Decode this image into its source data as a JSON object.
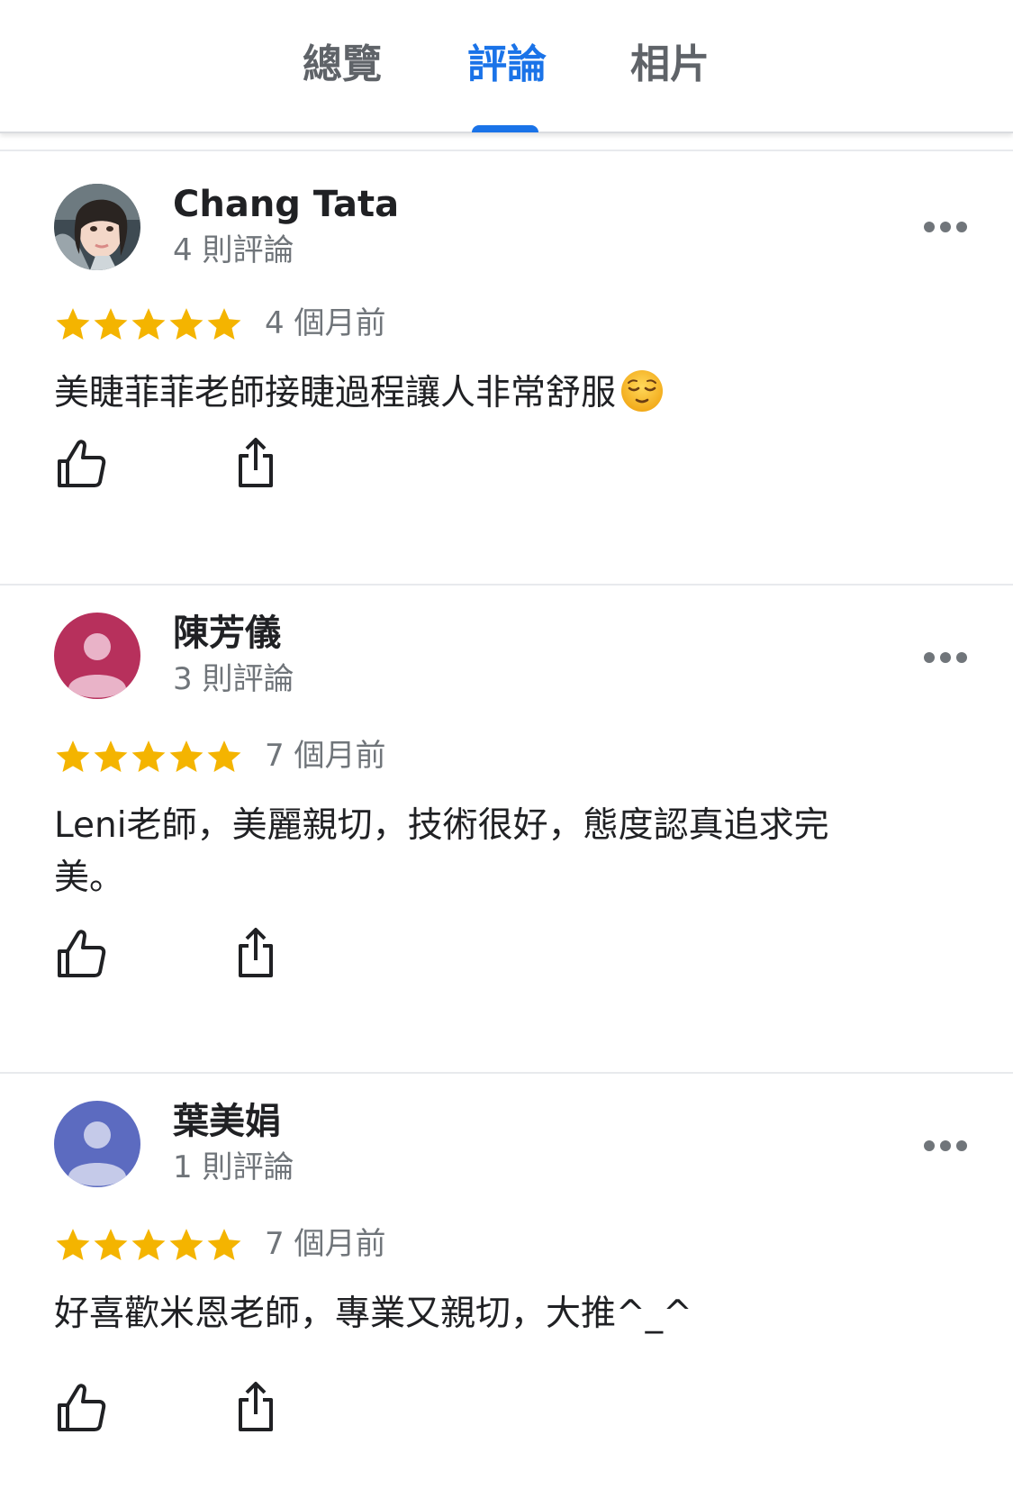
{
  "tabs": [
    {
      "label": "總覽",
      "active": false
    },
    {
      "label": "評論",
      "active": true
    },
    {
      "label": "相片",
      "active": false
    }
  ],
  "colors": {
    "accent": "#1a73e8",
    "star": "#f4b400",
    "secondary_text": "#70757a",
    "avatar_pink": "#b7305c",
    "avatar_indigo": "#5c6bc0"
  },
  "reviews": [
    {
      "name": "Chang Tata",
      "review_count": "4 則評論",
      "rating": 5,
      "time_ago": "4 個月前",
      "text": "美睫菲菲老師接睫過程讓人非常舒服",
      "emoji": "relieved-face-emoji",
      "avatar": "photo"
    },
    {
      "name": "陳芳儀",
      "review_count": "3 則評論",
      "rating": 5,
      "time_ago": "7 個月前",
      "text": "Leni老師，美麗親切，技術很好，態度認真追求完美。",
      "avatar": "pink-default"
    },
    {
      "name": "葉美娟",
      "review_count": "1 則評論",
      "rating": 5,
      "time_ago": "7 個月前",
      "text": "好喜歡米恩老師，專業又親切，大推^_^",
      "avatar": "indigo-default"
    }
  ],
  "icons": {
    "like": "thumbs-up-icon",
    "share": "share-icon",
    "more": "more-horizontal-icon"
  }
}
